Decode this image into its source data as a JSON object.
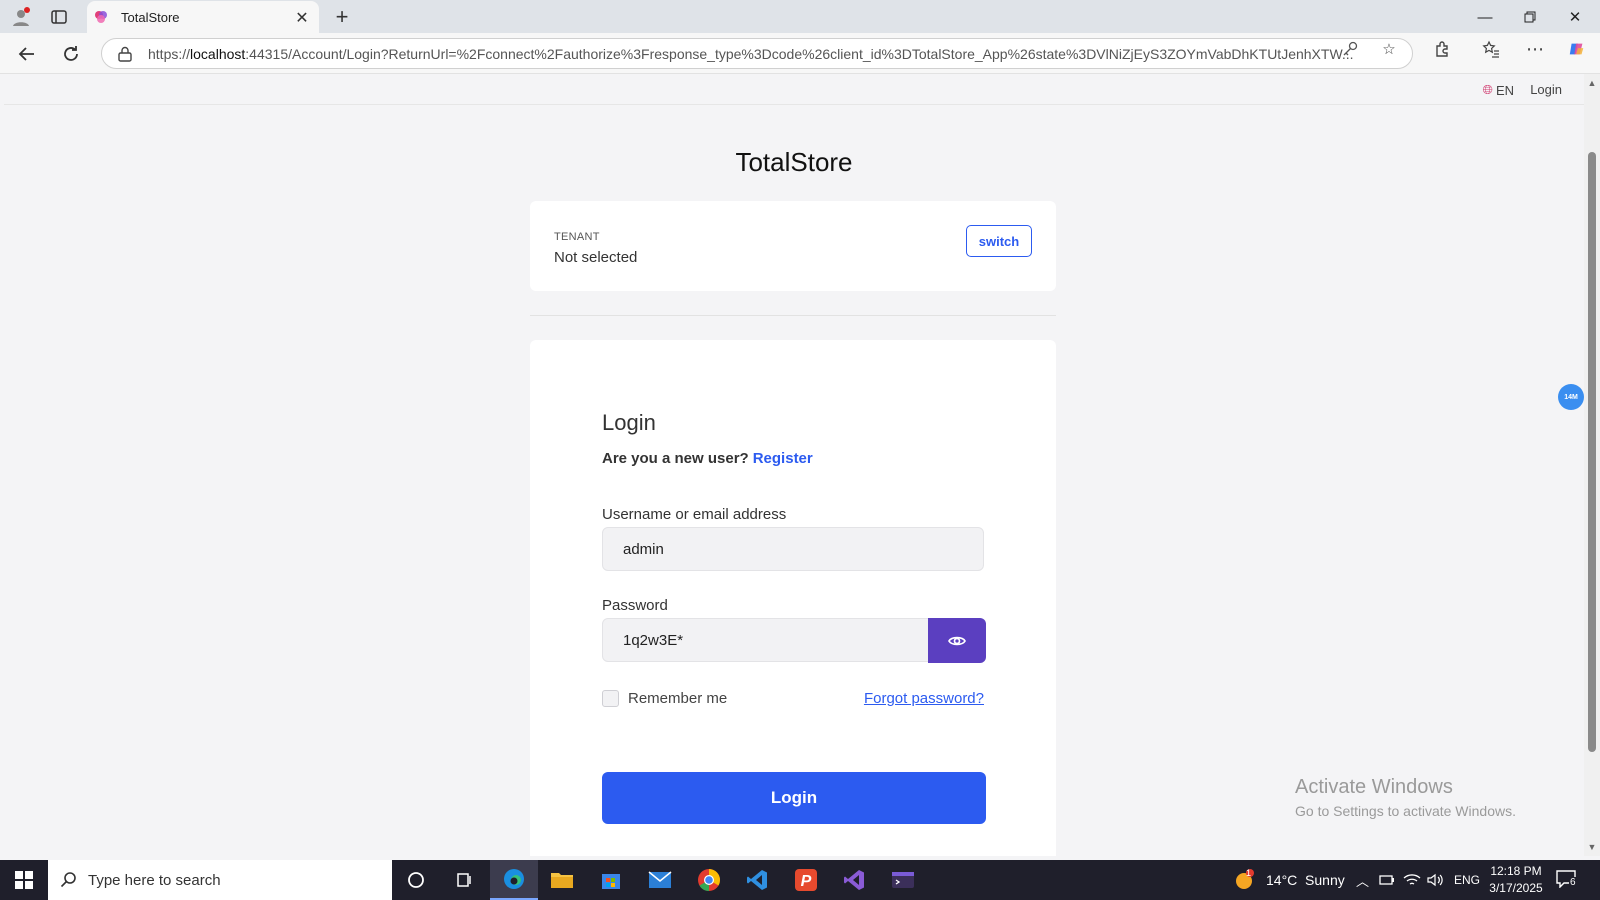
{
  "browser": {
    "tab_title": "TotalStore",
    "url_scheme": "https://",
    "url_host": "localhost",
    "url_rest": ":44315/Account/Login?ReturnUrl=%2Fconnect%2Fauthorize%3Fresponse_type%3Dcode%26client_id%3DTotalStore_App%26state%3DVlNiZjEyS3ZOYmVabDhKTUtJenhXTW..."
  },
  "page": {
    "language": "EN",
    "top_login": "Login",
    "brand": "TotalStore",
    "badge": "14M"
  },
  "tenant": {
    "label": "TENANT",
    "value": "Not selected",
    "switch_label": "switch"
  },
  "login": {
    "title": "Login",
    "new_user_text": "Are you a new user?",
    "register_link": "Register",
    "username_label": "Username or email address",
    "username_value": "admin",
    "password_label": "Password",
    "password_value": "1q2w3E*",
    "remember_label": "Remember me",
    "remember_checked": false,
    "forgot_link": "Forgot password?",
    "submit_label": "Login"
  },
  "watermark": {
    "line1": "Activate Windows",
    "line2": "Go to Settings to activate Windows."
  },
  "taskbar": {
    "search_placeholder": "Type here to search",
    "weather": "14°C  Sunny",
    "weather_badge": "1",
    "language": "ENG",
    "time": "12:18 PM",
    "date": "3/17/2025",
    "notification_count": "6"
  },
  "colors": {
    "primary": "#2c5bf0",
    "eye_button": "#5b3fc0",
    "page_bg": "#f4f4f6",
    "taskbar_bg": "#1f1f2b"
  }
}
